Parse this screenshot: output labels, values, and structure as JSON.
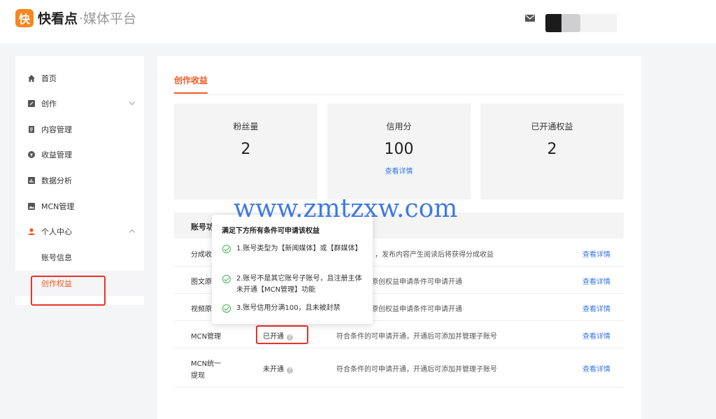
{
  "header": {
    "logo_glyph": "快",
    "brand_name": "快看点",
    "brand_sub": "·媒体平台",
    "icons": [
      "mail-icon"
    ]
  },
  "sidebar": {
    "items": [
      {
        "label": "首页",
        "icon": "home-icon"
      },
      {
        "label": "创作",
        "icon": "edit-icon"
      },
      {
        "label": "内容管理",
        "icon": "document-icon"
      },
      {
        "label": "收益管理",
        "icon": "coin-icon"
      },
      {
        "label": "数据分析",
        "icon": "chart-icon"
      },
      {
        "label": "MCN管理",
        "icon": "image-icon"
      },
      {
        "label": "个人中心",
        "icon": "user-icon"
      }
    ],
    "sub_items": [
      {
        "label": "账号信息"
      },
      {
        "label": "创作权益"
      }
    ]
  },
  "main": {
    "tab": "创作收益",
    "stats": [
      {
        "label": "粉丝量",
        "value": "2"
      },
      {
        "label": "信用分",
        "value": "100",
        "link": "查看详情"
      },
      {
        "label": "已开通权益",
        "value": "2"
      }
    ],
    "table": {
      "header_first": "账号功",
      "rows": [
        {
          "name": "分成收",
          "status": "",
          "desc": "，发布内容产生阅读后将获得分成收益",
          "link": "查看详情"
        },
        {
          "name": "图文原",
          "status": "",
          "desc": "原创权益申请条件可申请开通",
          "link": "查看详情"
        },
        {
          "name": "视频原",
          "status": "",
          "desc": "原创权益申请条件可申请开通",
          "link": "查看详情"
        },
        {
          "name": "MCN管理",
          "status": "已开通",
          "desc": "符合条件的可申请开通，开通后可添加并管理子账号",
          "link": "查看详情"
        },
        {
          "name": "MCN统一",
          "name2": "提现",
          "status": "未开通",
          "desc": "符合条件的可申请开通，开通后可添加并管理子账号",
          "link": "查看详情"
        }
      ]
    }
  },
  "popup": {
    "title": "满足下方所有条件可申请该权益",
    "conditions": [
      "1.账号类型为【新闻媒体】或【群媒体】",
      "2.账号不是其它账号子账号，且注册主体未开通【MCN管理】功能",
      "3.账号信用分满100，且未被封禁"
    ]
  },
  "watermark": "www.zmtzxw.com",
  "colors": {
    "accent": "#f05a23",
    "link": "#3478e5",
    "check": "#3fb454",
    "highlight": "#e7342b"
  }
}
